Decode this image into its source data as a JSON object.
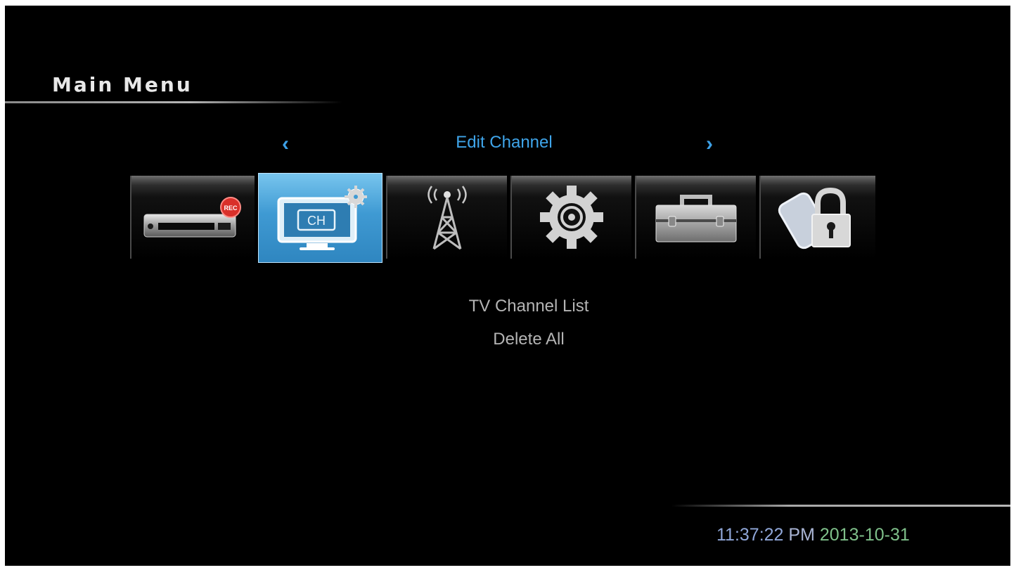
{
  "header": {
    "title": "Main Menu"
  },
  "category": {
    "current_label": "Edit Channel",
    "prev_arrow": "‹",
    "next_arrow": "›"
  },
  "tabs": [
    {
      "name": "record",
      "icon": "dvr-recorder-icon",
      "badge": "REC",
      "selected": false
    },
    {
      "name": "edit-channel",
      "icon": "tv-channel-icon",
      "label": "CH",
      "selected": true
    },
    {
      "name": "installation",
      "icon": "antenna-tower-icon",
      "selected": false
    },
    {
      "name": "system-setup",
      "icon": "gear-icon",
      "selected": false
    },
    {
      "name": "tools",
      "icon": "toolbox-icon",
      "selected": false
    },
    {
      "name": "parental-lock",
      "icon": "padlock-icon",
      "selected": false
    }
  ],
  "submenu": {
    "items": [
      "TV Channel List",
      "Delete All"
    ]
  },
  "status": {
    "time": "11:37:22",
    "ampm": "PM",
    "date": "2013-10-31"
  },
  "colors": {
    "accent": "#3fa5ea",
    "selected_tab": "#3f9ad3",
    "menu_text": "#b4b4b4",
    "background": "#000000"
  }
}
